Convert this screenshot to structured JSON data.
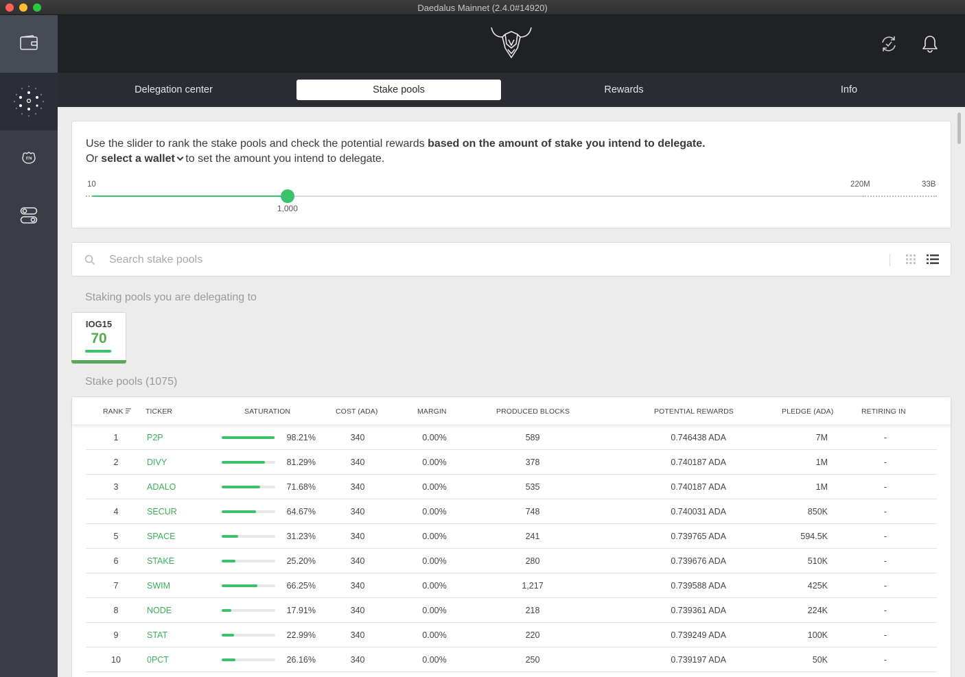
{
  "window": {
    "title": "Daedalus Mainnet (2.4.0#14920)"
  },
  "sidebar": {
    "items": [
      {
        "name": "wallets",
        "icon": "wallet-icon"
      },
      {
        "name": "staking",
        "icon": "staking-icon"
      },
      {
        "name": "itn",
        "icon": "itn-icon",
        "label": "ITN"
      },
      {
        "name": "settings",
        "icon": "settings-toggle-icon"
      }
    ]
  },
  "topbar": {
    "logo": "daedalus-logo",
    "icons": [
      "sync-icon",
      "bell-icon"
    ]
  },
  "tabs": [
    {
      "label": "Delegation center",
      "active": false
    },
    {
      "label": "Stake pools",
      "active": true
    },
    {
      "label": "Rewards",
      "active": false
    },
    {
      "label": "Info",
      "active": false
    }
  ],
  "slider_card": {
    "line1_normal": "Use the slider to rank the stake pools and check the potential rewards ",
    "line1_bold": "based on the amount of stake you intend to delegate.",
    "line2_prefix": "Or ",
    "line2_select": "select a wallet",
    "line2_suffix": " to set the amount you intend to delegate.",
    "min_label": "10",
    "mid_label": "220M",
    "max_label": "33B",
    "value_label": "1,000",
    "value_fraction": 0.253
  },
  "search": {
    "placeholder": "Search stake pools"
  },
  "delegating": {
    "heading": "Staking pools you are delegating to",
    "pool": {
      "ticker": "IOG15",
      "rank": "70",
      "saturation_fraction": 0.95
    }
  },
  "pools": {
    "heading": "Stake pools (1075)",
    "columns": {
      "rank": "RANK",
      "ticker": "TICKER",
      "saturation": "SATURATION",
      "cost": "COST (ADA)",
      "margin": "MARGIN",
      "blocks": "PRODUCED BLOCKS",
      "rewards": "POTENTIAL REWARDS",
      "pledge": "PLEDGE (ADA)",
      "retiring": "RETIRING IN"
    },
    "rows": [
      {
        "rank": "1",
        "ticker": "P2P",
        "saturation": "98.21%",
        "sat": 0.9821,
        "cost": "340",
        "margin": "0.00%",
        "blocks": "589",
        "rewards": "0.746438 ADA",
        "pledge": "7M",
        "retiring": "-"
      },
      {
        "rank": "2",
        "ticker": "DIVY",
        "saturation": "81.29%",
        "sat": 0.8129,
        "cost": "340",
        "margin": "0.00%",
        "blocks": "378",
        "rewards": "0.740187 ADA",
        "pledge": "1M",
        "retiring": "-"
      },
      {
        "rank": "3",
        "ticker": "ADALO",
        "saturation": "71.68%",
        "sat": 0.7168,
        "cost": "340",
        "margin": "0.00%",
        "blocks": "535",
        "rewards": "0.740187 ADA",
        "pledge": "1M",
        "retiring": "-"
      },
      {
        "rank": "4",
        "ticker": "SECUR",
        "saturation": "64.67%",
        "sat": 0.6467,
        "cost": "340",
        "margin": "0.00%",
        "blocks": "748",
        "rewards": "0.740031 ADA",
        "pledge": "850K",
        "retiring": "-"
      },
      {
        "rank": "5",
        "ticker": "SPACE",
        "saturation": "31.23%",
        "sat": 0.3123,
        "cost": "340",
        "margin": "0.00%",
        "blocks": "241",
        "rewards": "0.739765 ADA",
        "pledge": "594.5K",
        "retiring": "-"
      },
      {
        "rank": "6",
        "ticker": "STAKE",
        "saturation": "25.20%",
        "sat": 0.252,
        "cost": "340",
        "margin": "0.00%",
        "blocks": "280",
        "rewards": "0.739676 ADA",
        "pledge": "510K",
        "retiring": "-"
      },
      {
        "rank": "7",
        "ticker": "SWIM",
        "saturation": "66.25%",
        "sat": 0.6625,
        "cost": "340",
        "margin": "0.00%",
        "blocks": "1,217",
        "rewards": "0.739588 ADA",
        "pledge": "425K",
        "retiring": "-"
      },
      {
        "rank": "8",
        "ticker": "NODE",
        "saturation": "17.91%",
        "sat": 0.1791,
        "cost": "340",
        "margin": "0.00%",
        "blocks": "218",
        "rewards": "0.739361 ADA",
        "pledge": "224K",
        "retiring": "-"
      },
      {
        "rank": "9",
        "ticker": "STAT",
        "saturation": "22.99%",
        "sat": 0.2299,
        "cost": "340",
        "margin": "0.00%",
        "blocks": "220",
        "rewards": "0.739249 ADA",
        "pledge": "100K",
        "retiring": "-"
      },
      {
        "rank": "10",
        "ticker": "0PCT",
        "saturation": "26.16%",
        "sat": 0.2616,
        "cost": "340",
        "margin": "0.00%",
        "blocks": "250",
        "rewards": "0.739197 ADA",
        "pledge": "50K",
        "retiring": "-"
      }
    ]
  },
  "colors": {
    "accent_green": "#3cc26a",
    "ticker_green": "#3cae5a",
    "sidebar_bg": "#3a3d46",
    "topbar_bg": "#202125"
  }
}
